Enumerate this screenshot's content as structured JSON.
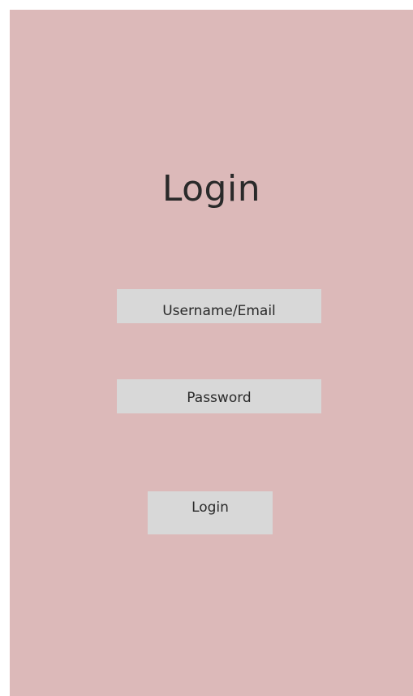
{
  "screen": {
    "title": "Login",
    "background_color": "#dcb9b9"
  },
  "form": {
    "username_label": "Username/Email",
    "password_label": "Password",
    "login_button_label": "Login"
  }
}
